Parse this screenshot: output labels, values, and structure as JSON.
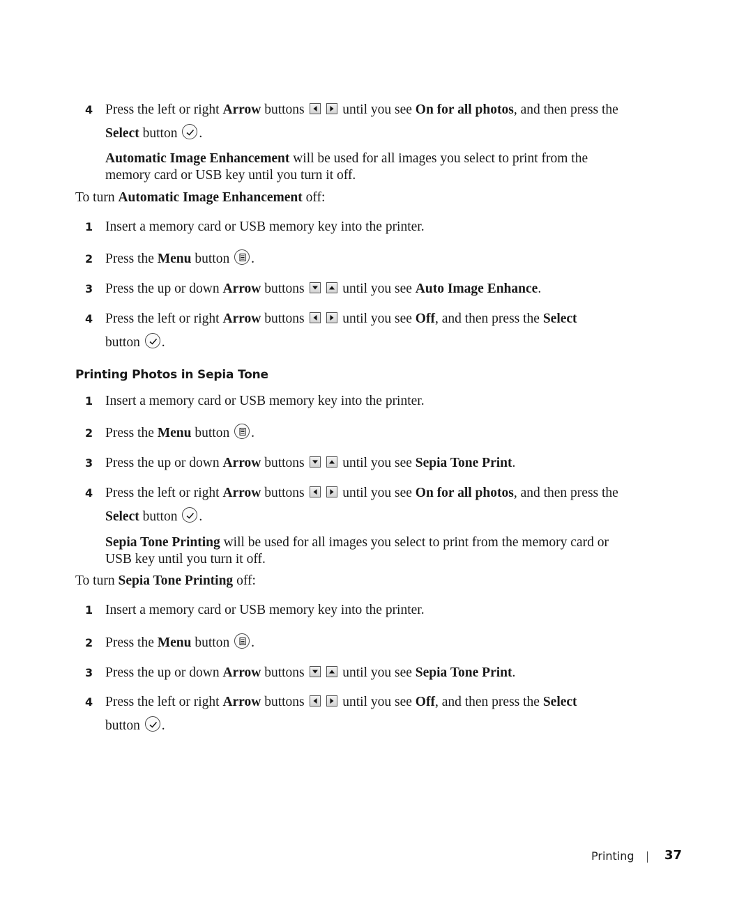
{
  "section1": {
    "step4": {
      "num": "4",
      "t1": "Press the left or right ",
      "b1": "Arrow",
      "t2": " buttons ",
      "t3": " until you see ",
      "b2": "On for all photos",
      "t4": ", and then press the ",
      "b3": "Select",
      "t5": " button ",
      "t6": "."
    },
    "note": {
      "b1": "Automatic Image Enhancement",
      "t1": " will be used for all images you select to print from the memory card or USB key until you turn it off."
    },
    "off_lead": {
      "t1": "To turn ",
      "b1": "Automatic Image Enhancement",
      "t2": " off:"
    },
    "off_steps": [
      {
        "num": "1",
        "text": "Insert a memory card or USB memory key into the printer."
      },
      {
        "num": "2",
        "t1": "Press the ",
        "b1": "Menu",
        "t2": " button ",
        "t3": "."
      },
      {
        "num": "3",
        "t1": "Press the up or down ",
        "b1": "Arrow",
        "t2": " buttons ",
        "t3": " until you see ",
        "b2": "Auto Image Enhance",
        "t4": "."
      },
      {
        "num": "4",
        "t1": "Press the left or right ",
        "b1": "Arrow",
        "t2": " buttons ",
        "t3": " until you see ",
        "b2": "Off",
        "t4": ", and then press the ",
        "b3": "Select",
        "t5": " button ",
        "t6": "."
      }
    ]
  },
  "section2": {
    "heading": "Printing Photos in Sepia Tone",
    "steps": [
      {
        "num": "1",
        "text": "Insert a memory card or USB memory key into the printer."
      },
      {
        "num": "2",
        "t1": "Press the ",
        "b1": "Menu",
        "t2": " button ",
        "t3": "."
      },
      {
        "num": "3",
        "t1": "Press the up or down ",
        "b1": "Arrow",
        "t2": " buttons ",
        "t3": " until you see ",
        "b2": "Sepia Tone Print",
        "t4": "."
      },
      {
        "num": "4",
        "t1": "Press the left or right ",
        "b1": "Arrow",
        "t2": " buttons ",
        "t3": " until you see ",
        "b2": "On for all photos",
        "t4": ", and then press the ",
        "b3": "Select",
        "t5": " button ",
        "t6": "."
      }
    ],
    "note": {
      "b1": "Sepia Tone Printing",
      "t1": " will be used for all images you select to print from the memory card or USB key until you turn it off."
    },
    "off_lead": {
      "t1": "To turn ",
      "b1": "Sepia Tone Printing",
      "t2": " off:"
    },
    "off_steps": [
      {
        "num": "1",
        "text": "Insert a memory card or USB memory key into the printer."
      },
      {
        "num": "2",
        "t1": "Press the ",
        "b1": "Menu",
        "t2": " button ",
        "t3": "."
      },
      {
        "num": "3",
        "t1": "Press the up or down ",
        "b1": "Arrow",
        "t2": " buttons ",
        "t3": " until you see ",
        "b2": "Sepia Tone Print",
        "t4": "."
      },
      {
        "num": "4",
        "t1": "Press the left or right ",
        "b1": "Arrow",
        "t2": " buttons ",
        "t3": " until you see ",
        "b2": "Off",
        "t4": ", and then press the ",
        "b3": "Select",
        "t5": " button ",
        "t6": "."
      }
    ]
  },
  "footer": {
    "section": "Printing",
    "page_number": "37"
  }
}
